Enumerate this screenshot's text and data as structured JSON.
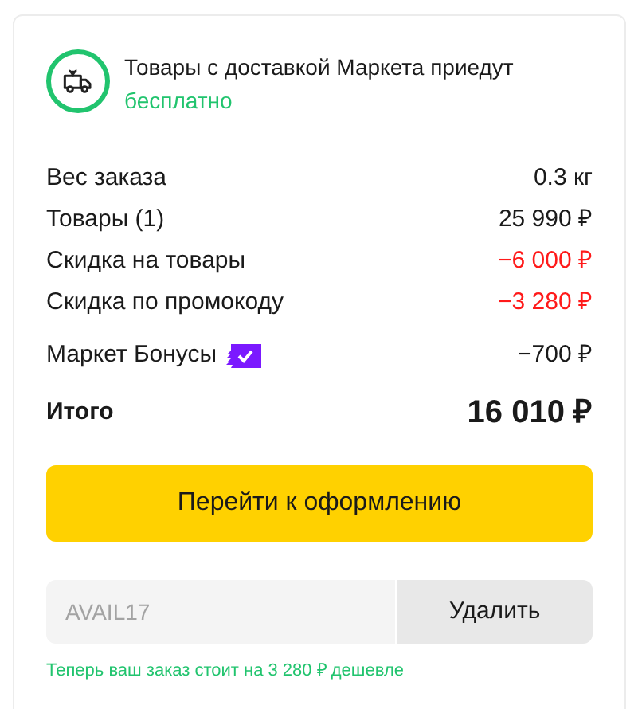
{
  "delivery_notice": {
    "text": "Товары с доставкой Маркета приедут",
    "highlight": "бесплатно"
  },
  "summary_rows": [
    {
      "kind": "plain",
      "label": "Вес заказа",
      "value": "0.3 кг"
    },
    {
      "kind": "plain",
      "label": "Товары (1)",
      "value": "25 990 ₽"
    },
    {
      "kind": "discount",
      "label": "Скидка на товары",
      "value": "−6 000 ₽"
    },
    {
      "kind": "discount",
      "label": "Скидка по промокоду",
      "value": "−3 280 ₽"
    },
    {
      "kind": "bonus",
      "label": "Маркет Бонусы",
      "value": "−700 ₽"
    }
  ],
  "total": {
    "label": "Итого",
    "value": "16 010 ₽"
  },
  "checkout_button": "Перейти к оформлению",
  "promo": {
    "placeholder": "AVAIL17",
    "button": "Удалить",
    "message": "Теперь ваш заказ стоит на 3 280 ₽ дешевле"
  }
}
